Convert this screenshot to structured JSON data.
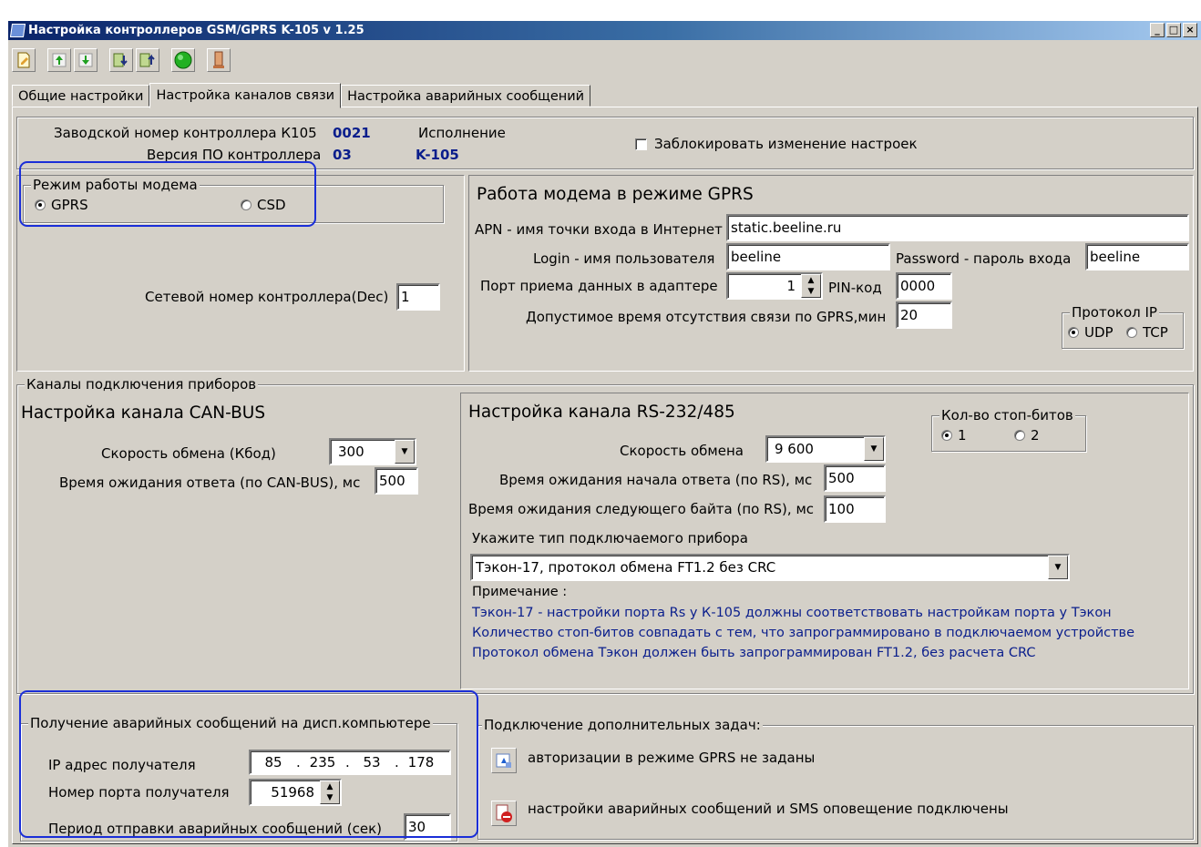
{
  "window": {
    "title": "Настройка контроллеров GSM/GPRS K-105   v 1.25",
    "buttons": [
      "_",
      "□",
      "×"
    ]
  },
  "toolbar": {
    "icons": [
      "edit-icon",
      "arrow-up-icon",
      "arrow-down-icon",
      "import-icon",
      "export-icon",
      "connect-icon",
      "device-icon"
    ]
  },
  "tabs": [
    {
      "label": "Общие настройки"
    },
    {
      "label": "Настройка каналов связи"
    },
    {
      "label": "Настройка аварийных сообщений"
    }
  ],
  "header": {
    "serial_label": "Заводской номер контроллера К105",
    "serial_value": "0021",
    "fw_label": "Версия ПО контроллера",
    "fw_value": "03",
    "exec_label": "Исполнение",
    "exec_value": "K-105",
    "lock_label": "Заблокировать изменение настроек"
  },
  "modem_mode": {
    "legend": "Режим работы модема",
    "opt_gprs": "GPRS",
    "opt_csd": "CSD",
    "selected": "GPRS",
    "net_label": "Сетевой номер контроллера(Dec)",
    "net_value": "1"
  },
  "gprs": {
    "title": "Работа модема в режиме GPRS",
    "apn_label": "APN - имя точки входа в Интернет",
    "apn_value": "static.beeline.ru",
    "login_label": "Login - имя пользователя",
    "login_value": "beeline",
    "password_label": "Password  - пароль входа",
    "password_value": "beeline",
    "port_label": "Порт приема данных в адаптере",
    "port_value": "1",
    "pin_label": "PIN-код",
    "pin_value": "0000",
    "timeout_label": "Допустимое время отсутствия связи по GPRS,мин",
    "timeout_value": "20",
    "protocol_legend": "Протокол IP",
    "opt_udp": "UDP",
    "opt_tcp": "TCP",
    "protocol_selected": "UDP"
  },
  "channels": {
    "legend": "Каналы подключения приборов",
    "can": {
      "title": "Настройка  канала CAN-BUS",
      "speed_label": "Скорость обмена (Кбод)",
      "speed_value": "300",
      "wait_label": "Время ожидания ответа (по CAN-BUS), мс",
      "wait_value": "500"
    },
    "rs": {
      "title": "Настройка канала RS-232/485",
      "stopbits_legend": "Кол-во стоп-битов",
      "opt_1": "1",
      "opt_2": "2",
      "stopbits_selected": "1",
      "speed_label": "Скорость обмена",
      "speed_value": "9 600",
      "start_label": "Время ожидания начала ответа (по RS), мс",
      "start_value": "500",
      "next_label": "Время ожидания следующего байта (по RS), мс",
      "next_value": "100",
      "device_label": "Укажите тип подключаемого прибора",
      "device_value": "Тэкон-17, протокол обмена FT1.2 без CRC",
      "note_label": "Примечание :",
      "note_line1": "Тэкон-17 - настройки порта Rs у К-105 должны соответствовать настройкам порта у Тэкон",
      "note_line2": "Количество стоп-битов совпадать с тем, что запрограммировано в подключаемом устройстве",
      "note_line3": "Протокол обмена Тэкон должен быть запрограммирован FT1.2, без расчета CRC"
    }
  },
  "alarm": {
    "legend": "Получение аварийных сообщений на дисп.компьютере",
    "ip_label": "IP адрес получателя",
    "ip": [
      "85",
      "235",
      "53",
      "178"
    ],
    "port_label": "Номер порта получателя",
    "port_value": "51968",
    "period_label": "Период  отправки  аварийных сообщений (сек)",
    "period_value": "30"
  },
  "tasks": {
    "legend": "Подключение дополнительных задач:",
    "item1": "авторизации в режиме GPRS не заданы",
    "item2": "настройки аварийных сообщений и SMS оповещение подключены"
  }
}
